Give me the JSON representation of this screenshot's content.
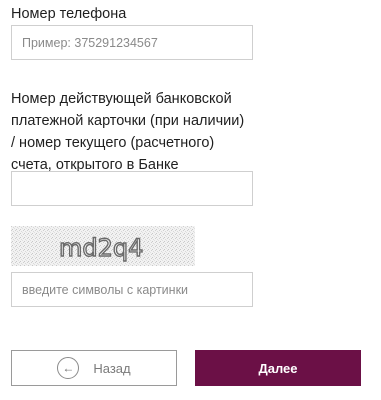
{
  "phone": {
    "label": "Номер телефона",
    "placeholder": "Пример: 375291234567",
    "value": ""
  },
  "card": {
    "label_lines": [
      "Номер действующей банковской",
      "платежной карточки (при наличии)",
      "/ номер текущего (расчетного)",
      "счета, открытого в Банке"
    ],
    "value": ""
  },
  "captcha": {
    "image_text": "md2q4",
    "placeholder": "введите символы с картинки",
    "value": ""
  },
  "buttons": {
    "back_label": "Назад",
    "next_label": "Далее"
  },
  "colors": {
    "accent": "#6b1046",
    "field_border": "#cfcfcf"
  }
}
